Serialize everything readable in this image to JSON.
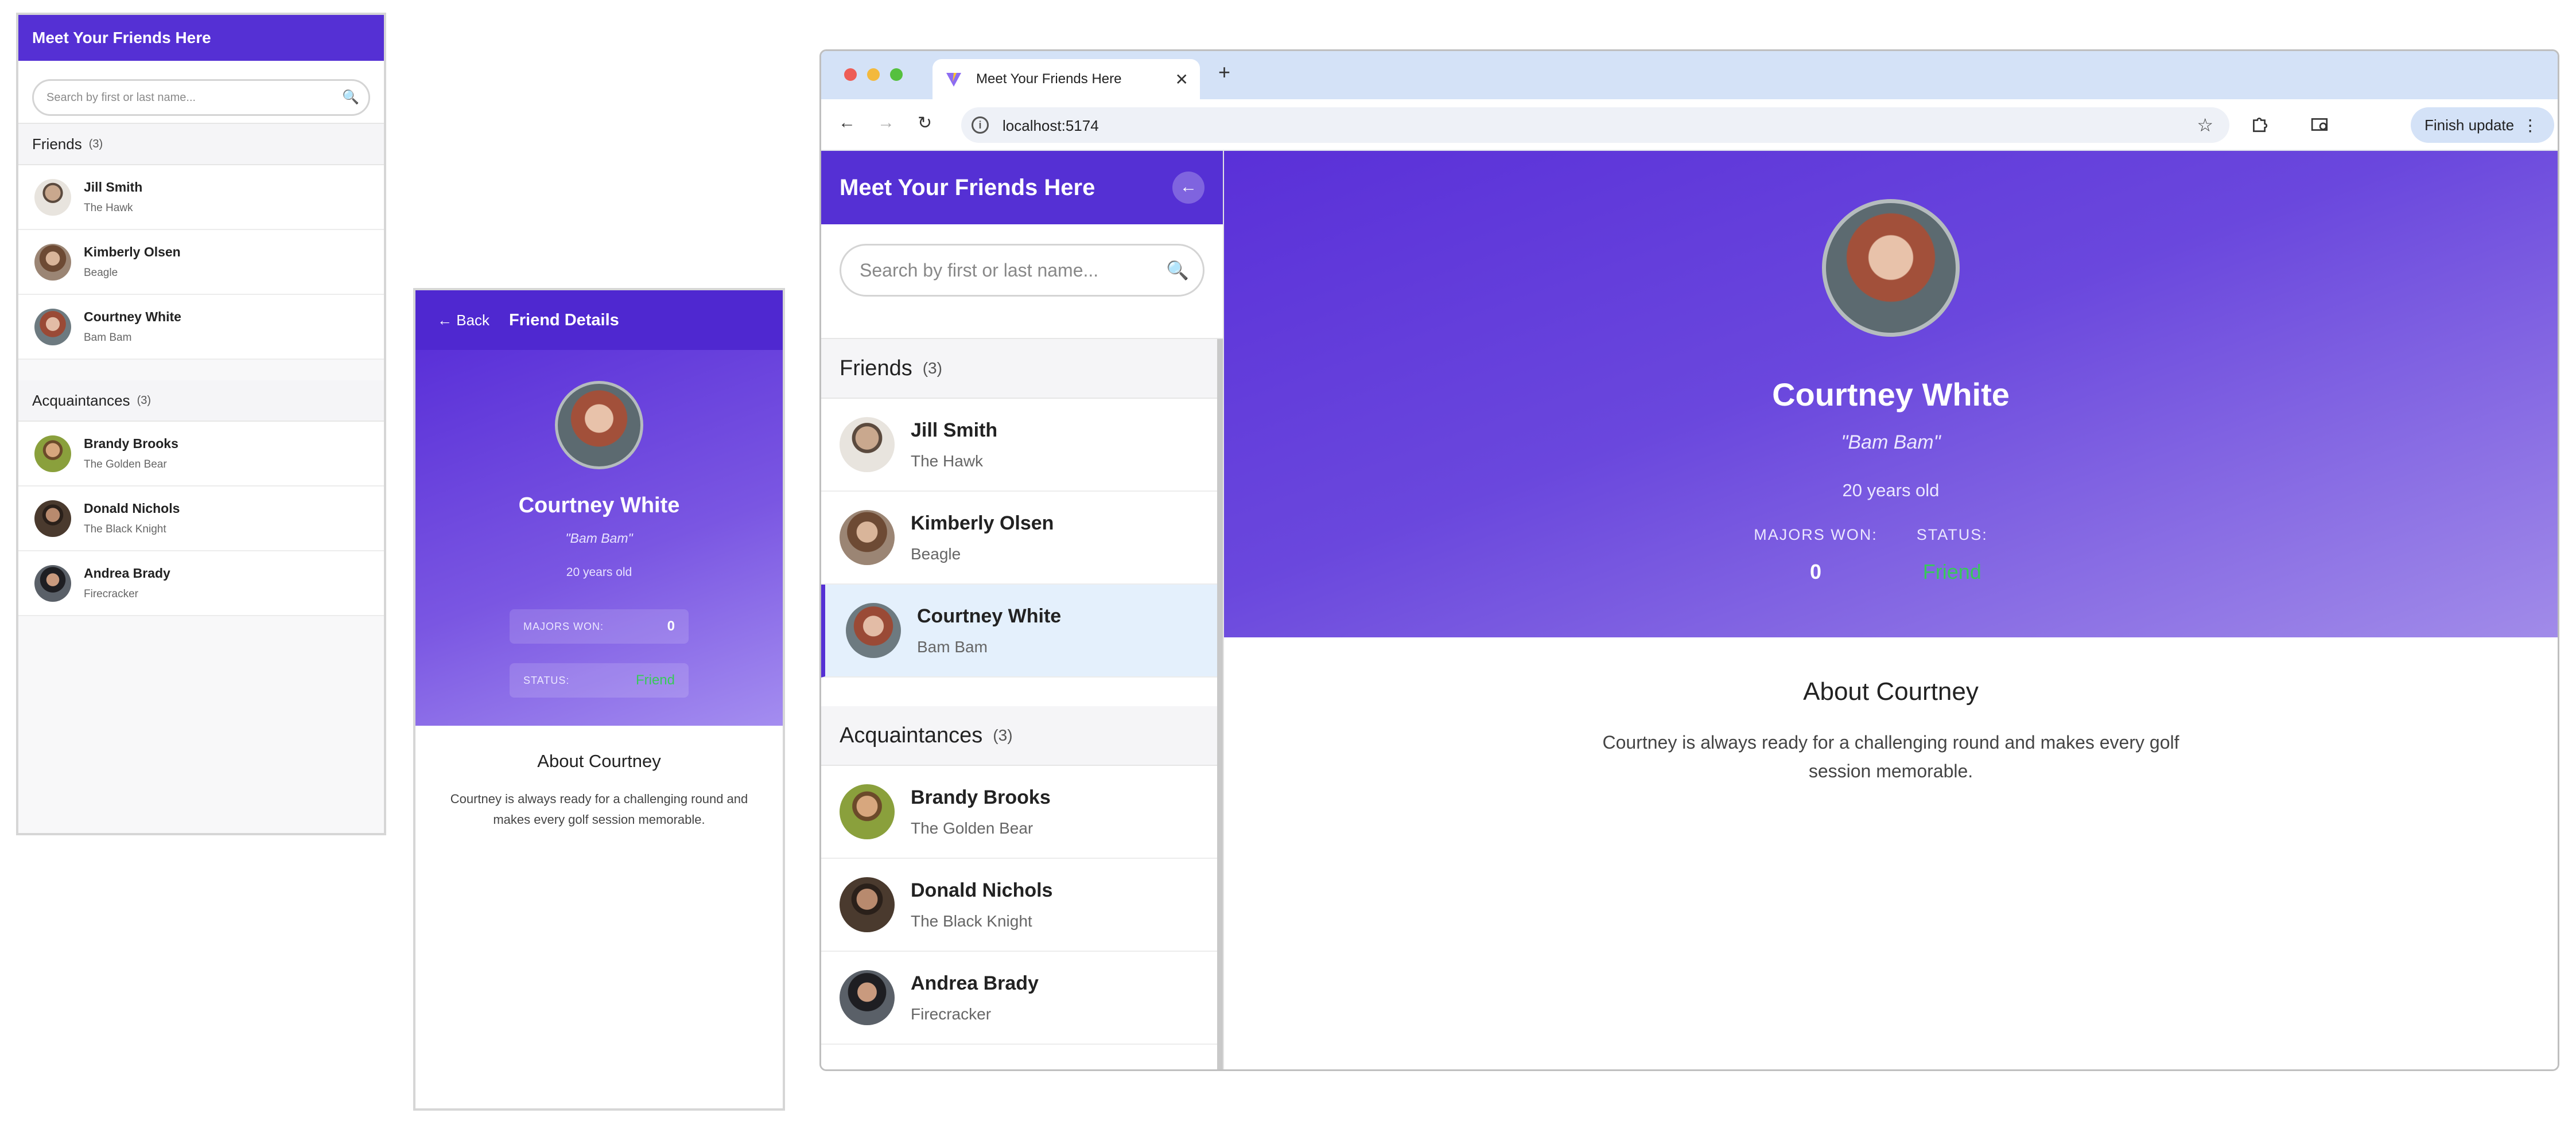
{
  "app_title": "Meet Your Friends Here",
  "search_placeholder": "Search by first or last name...",
  "sections": {
    "friends": {
      "title": "Friends",
      "count": "(3)"
    },
    "acquaintances": {
      "title": "Acquaintances",
      "count": "(3)"
    }
  },
  "friends": [
    {
      "name": "Jill Smith",
      "nickname": "The Hawk",
      "avatar_color": "#d9d2c8"
    },
    {
      "name": "Kimberly Olsen",
      "nickname": "Beagle",
      "avatar_color": "#8a6a56"
    },
    {
      "name": "Courtney White",
      "nickname": "Bam Bam",
      "avatar_color": "#9a5a48"
    }
  ],
  "acquaintances": [
    {
      "name": "Brandy Brooks",
      "nickname": "The Golden Bear",
      "avatar_color": "#7a8a3a"
    },
    {
      "name": "Donald Nichols",
      "nickname": "The Black Knight",
      "avatar_color": "#3a2e28"
    },
    {
      "name": "Andrea Brady",
      "nickname": "Firecracker",
      "avatar_color": "#3c4046"
    }
  ],
  "mobile_detail": {
    "back_label": "← Back",
    "title": "Friend Details"
  },
  "selected": {
    "name": "Courtney White",
    "nickname": "\"Bam Bam\"",
    "age": "20 years old",
    "majors_label": "MAJORS WON:",
    "majors_value": "0",
    "status_label": "STATUS:",
    "status_value": "Friend",
    "about_title": "About Courtney",
    "about_text": "Courtney is always ready for a challenging round and makes every golf session memorable."
  },
  "browser": {
    "tab_title": "Meet Your Friends Here",
    "url": "localhost:5174",
    "finish_update": "Finish update"
  },
  "colors": {
    "brand": "#5530d4",
    "status_green": "#38c95a",
    "selected_bg": "#e4f0fc"
  },
  "icons": {
    "search": "search-icon",
    "back": "arrow-left-icon",
    "collapse": "arrow-left-icon",
    "reload": "reload-icon",
    "star": "star-icon",
    "extensions": "puzzle-icon",
    "close_tab": "close-icon"
  }
}
